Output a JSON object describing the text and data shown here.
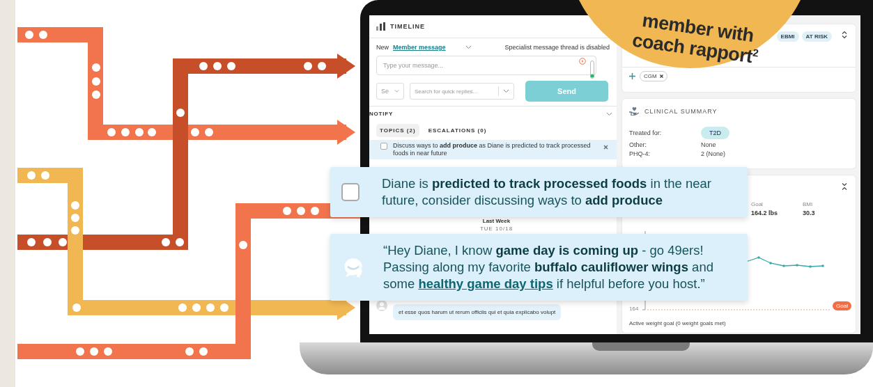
{
  "badge": {
    "lines": [
      "member with",
      "coach rapport$^{2}$"
    ]
  },
  "timeline": {
    "title": "TIMELINE",
    "compose": {
      "new_label": "New",
      "type_link": "Member message",
      "notice": "Specialist message thread is disabled",
      "message_placeholder": "Type your message...",
      "select_value": "Se",
      "quick_reply_placeholder": "Search for quick replies...",
      "send_label": "Send",
      "send_disabled": true
    },
    "notify": {
      "title": "NOTIFY",
      "tabs": [
        {
          "label": "TOPICS (2)",
          "selected": true
        },
        {
          "label": "ESCALATIONS (0)",
          "selected": false
        }
      ],
      "topics": [
        {
          "text": "Discuss ways to **add produce** as Diane is predicted to track processed foods in near future",
          "checked": false
        }
      ]
    },
    "history": {
      "week": "Last Week",
      "date": "TUE 10/18",
      "messages": [
        {
          "text": "et esse quos harum ut rerum officiis qui et quia explicabo volupt"
        }
      ]
    }
  },
  "member_card": {
    "tags": [
      "EBMI",
      "AT RISK"
    ],
    "devices": [
      {
        "label": "CGM"
      }
    ]
  },
  "clinical_summary": {
    "title": "CLINICAL SUMMARY",
    "rows": [
      {
        "label": "Treated for:",
        "value": "T2D",
        "kind": "chip"
      },
      {
        "label": "Other:",
        "value": "None",
        "kind": "text"
      },
      {
        "label": "PHQ-4:",
        "value": "2 (None)",
        "kind": "text"
      }
    ]
  },
  "weight_card": {
    "stats": [
      {
        "label": "Goal",
        "value": "164.2 lbs"
      },
      {
        "label": "BMI",
        "value": "30.3"
      }
    ],
    "axis_label": "164",
    "goal_label": "Goal",
    "caption": "Active weight goal (0 weight goals met)"
  },
  "callouts": [
    {
      "kind": "topic",
      "checked": false,
      "parts": [
        {
          "kind": "text",
          "text": "Diane is **predicted to track processed foods** in the near future, consider discussing ways to **add produce**"
        }
      ]
    },
    {
      "kind": "message",
      "parts": [
        {
          "kind": "text",
          "text": "“Hey Diane, I know **game day is coming up** - go 49ers! Passing along my favorite **buffalo cauliflower wings** and some "
        },
        {
          "kind": "link",
          "text": "healthy game day tips"
        },
        {
          "kind": "text",
          "text": " if helpful before you host.”"
        }
      ]
    }
  ]
}
